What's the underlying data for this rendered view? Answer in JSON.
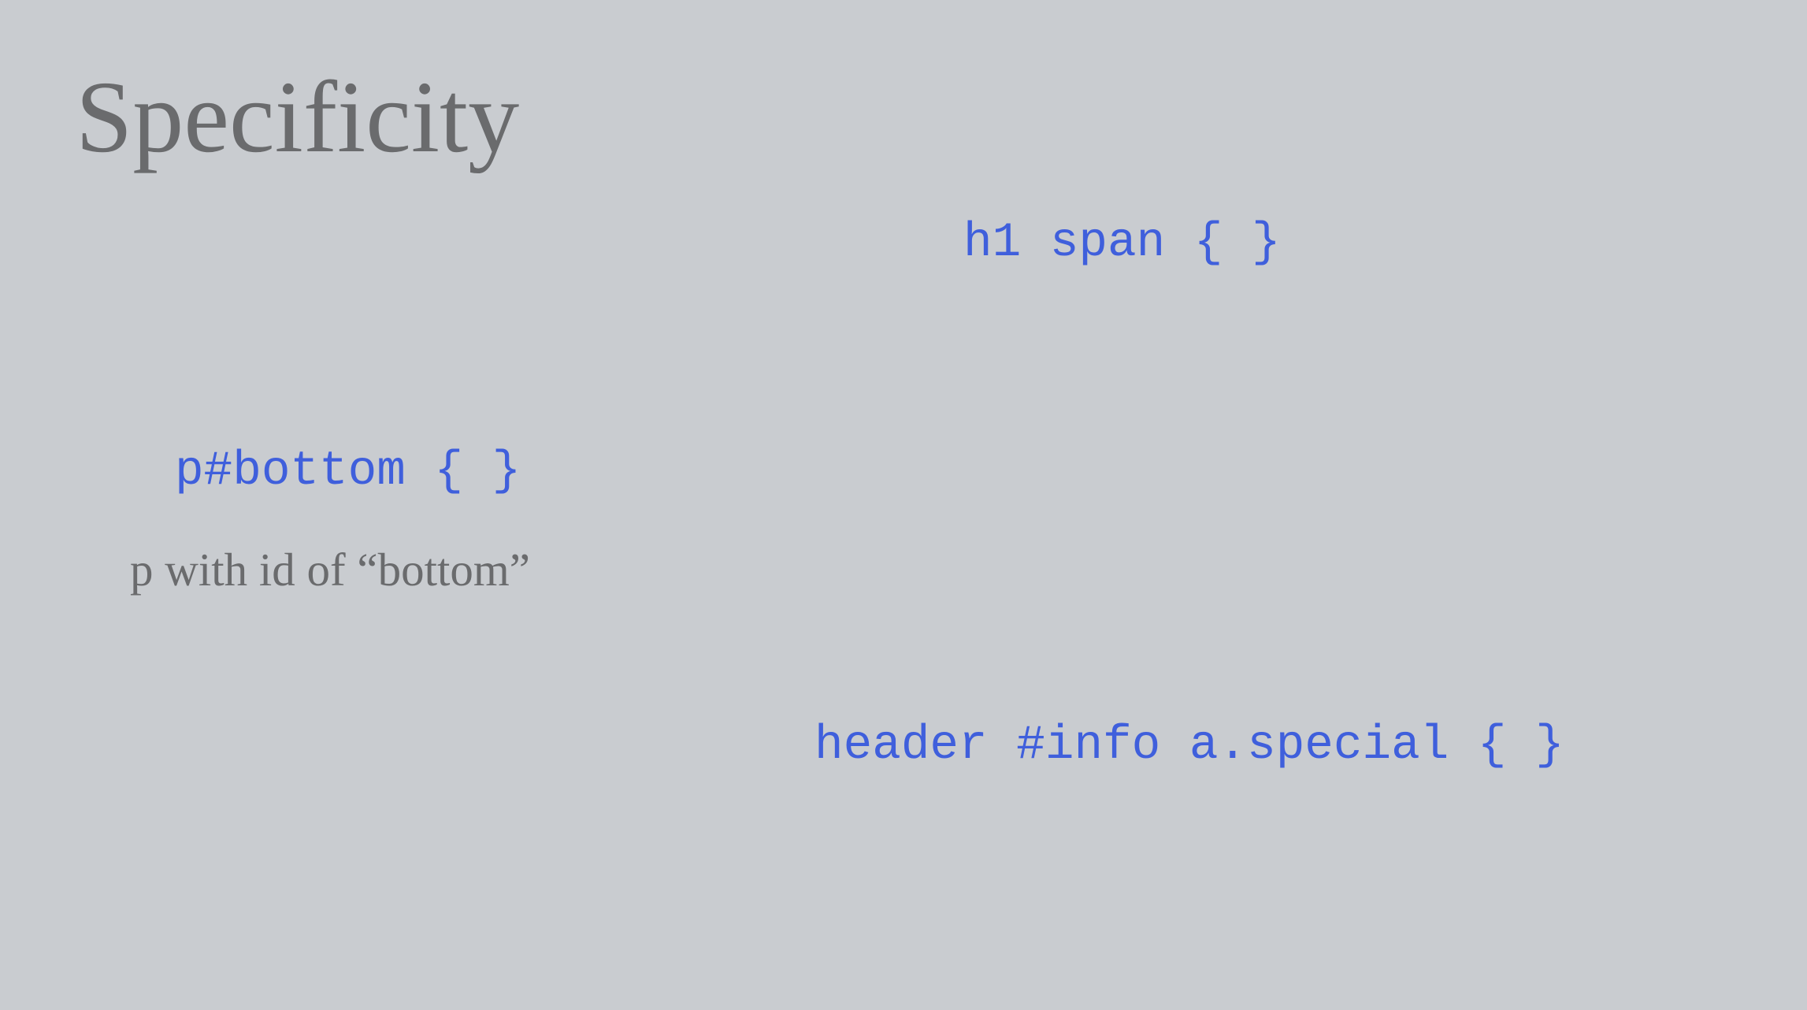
{
  "slide": {
    "title": "Specificity",
    "selectors": [
      {
        "code": "h1 span { }"
      },
      {
        "code": "p#bottom { }",
        "description": "p with id of “bottom”"
      },
      {
        "code": "header #info a.special { }"
      }
    ]
  },
  "colors": {
    "background": "#c9ccd0",
    "code": "#3f5fdc",
    "text": "#6a6b6d"
  }
}
